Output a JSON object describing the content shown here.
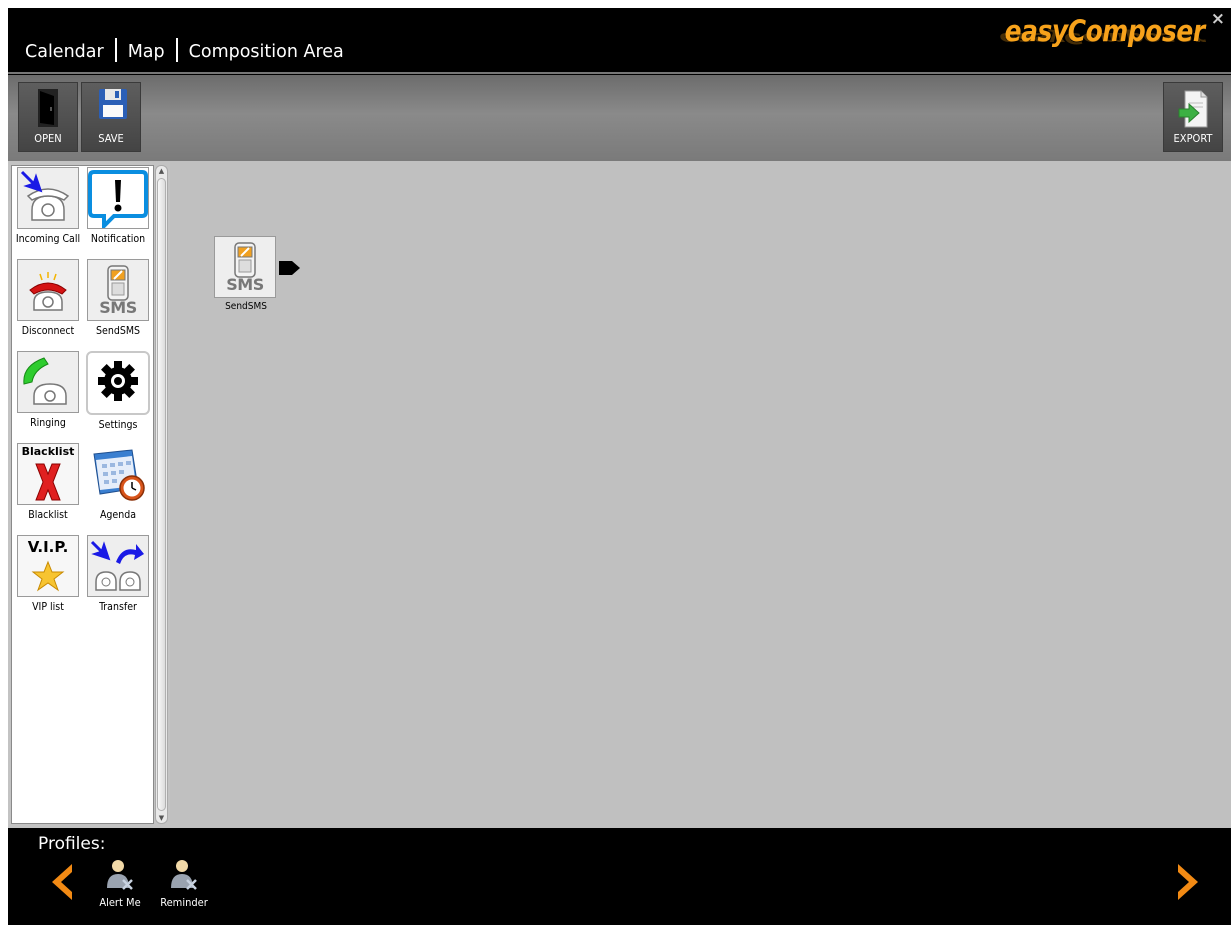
{
  "nav": {
    "calendar": "Calendar",
    "map": "Map",
    "composition": "Composition Area"
  },
  "logo": {
    "text": "easyComposer",
    "glyph": "e"
  },
  "window": {
    "close_glyph": "×"
  },
  "toolbar": {
    "open_label": "OPEN",
    "save_label": "SAVE",
    "export_label": "EXPORT"
  },
  "palette": {
    "items": [
      {
        "label": "Incoming Call",
        "icon": "incoming-call-icon"
      },
      {
        "label": "Notification",
        "icon": "notification-icon"
      },
      {
        "label": "Disconnect",
        "icon": "disconnect-icon"
      },
      {
        "label": "SendSMS",
        "icon": "sms-phone-icon"
      },
      {
        "label": "Ringing",
        "icon": "ringing-icon"
      },
      {
        "label": "Settings",
        "icon": "settings-gear-icon"
      },
      {
        "label": "Blacklist",
        "icon": "blacklist-icon",
        "icon_text": "Blacklist"
      },
      {
        "label": "Agenda",
        "icon": "agenda-calendar-icon"
      },
      {
        "label": "VIP list",
        "icon": "vip-star-icon",
        "icon_text": "V.I.P."
      },
      {
        "label": "Transfer",
        "icon": "transfer-call-icon"
      }
    ],
    "sms_icon_text": "SMS"
  },
  "canvas": {
    "node": {
      "label": "SendSMS",
      "icon_text": "SMS"
    }
  },
  "footer": {
    "title": "Profiles:",
    "profiles": [
      {
        "label": "Alert Me"
      },
      {
        "label": "Reminder"
      }
    ]
  },
  "colors": {
    "accent": "#f7a21b",
    "header_bg": "#000000",
    "canvas_bg": "#c0c0c0",
    "toolbar_bg": "#7a7a7a"
  }
}
